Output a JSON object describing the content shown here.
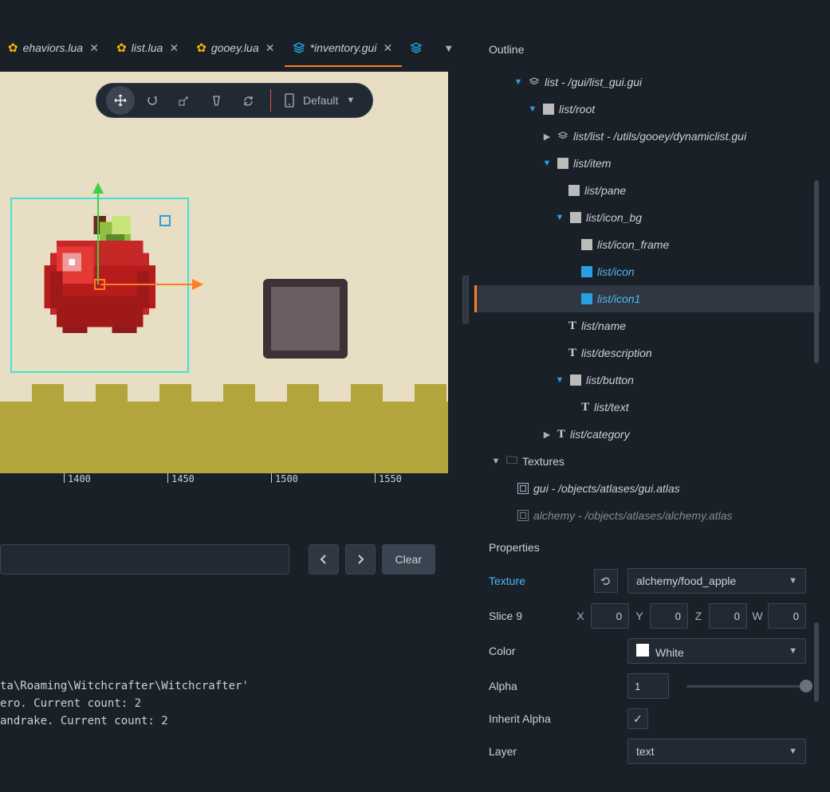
{
  "tabs": [
    {
      "label": "ehaviors.lua",
      "icon": "gear"
    },
    {
      "label": "list.lua",
      "icon": "gear"
    },
    {
      "label": "gooey.lua",
      "icon": "gear"
    },
    {
      "label": "*inventory.gui",
      "icon": "stack",
      "active": true
    },
    {
      "label": "",
      "icon": "stack"
    }
  ],
  "tab_overflow": "▼",
  "viewport": {
    "toolbar_default": "Default",
    "ruler": [
      "1400",
      "1450",
      "1500",
      "1550"
    ]
  },
  "console": {
    "clear": "Clear",
    "lines": "ta\\Roaming\\Witchcrafter\\Witchcrafter'\nero. Current count: 2\nandrake. Current count: 2"
  },
  "outline": {
    "title": "Outline",
    "nodes": {
      "n0": "list - /gui/list_gui.gui",
      "n1": "list/root",
      "n2": "list/list - /utils/gooey/dynamiclist.gui",
      "n3": "list/item",
      "n4": "list/pane",
      "n5": "list/icon_bg",
      "n6": "list/icon_frame",
      "n7": "list/icon",
      "n8": "list/icon1",
      "n9": "list/name",
      "n10": "list/description",
      "n11": "list/button",
      "n12": "list/text",
      "n13": "list/category",
      "n14": "Textures",
      "n15": "gui - /objects/atlases/gui.atlas",
      "n16": "alchemy - /objects/atlases/alchemy.atlas"
    }
  },
  "properties": {
    "title": "Properties",
    "texture_label": "Texture",
    "texture_value": "alchemy/food_apple",
    "slice9_label": "Slice 9",
    "slice9": {
      "X": "0",
      "Y": "0",
      "Z": "0",
      "W": "0"
    },
    "color_label": "Color",
    "color_value": "White",
    "alpha_label": "Alpha",
    "alpha_value": "1",
    "inherit_label": "Inherit Alpha",
    "layer_label": "Layer",
    "layer_value": "text"
  }
}
